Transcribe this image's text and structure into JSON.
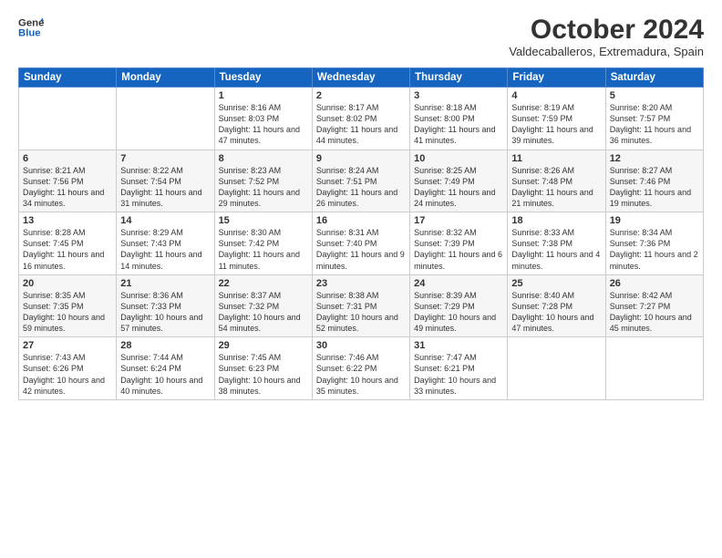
{
  "logo": {
    "line1": "General",
    "line2": "Blue"
  },
  "title": "October 2024",
  "subtitle": "Valdecaballeros, Extremadura, Spain",
  "weekdays": [
    "Sunday",
    "Monday",
    "Tuesday",
    "Wednesday",
    "Thursday",
    "Friday",
    "Saturday"
  ],
  "weeks": [
    [
      {
        "day": "",
        "detail": ""
      },
      {
        "day": "",
        "detail": ""
      },
      {
        "day": "1",
        "detail": "Sunrise: 8:16 AM\nSunset: 8:03 PM\nDaylight: 11 hours and 47 minutes."
      },
      {
        "day": "2",
        "detail": "Sunrise: 8:17 AM\nSunset: 8:02 PM\nDaylight: 11 hours and 44 minutes."
      },
      {
        "day": "3",
        "detail": "Sunrise: 8:18 AM\nSunset: 8:00 PM\nDaylight: 11 hours and 41 minutes."
      },
      {
        "day": "4",
        "detail": "Sunrise: 8:19 AM\nSunset: 7:59 PM\nDaylight: 11 hours and 39 minutes."
      },
      {
        "day": "5",
        "detail": "Sunrise: 8:20 AM\nSunset: 7:57 PM\nDaylight: 11 hours and 36 minutes."
      }
    ],
    [
      {
        "day": "6",
        "detail": "Sunrise: 8:21 AM\nSunset: 7:56 PM\nDaylight: 11 hours and 34 minutes."
      },
      {
        "day": "7",
        "detail": "Sunrise: 8:22 AM\nSunset: 7:54 PM\nDaylight: 11 hours and 31 minutes."
      },
      {
        "day": "8",
        "detail": "Sunrise: 8:23 AM\nSunset: 7:52 PM\nDaylight: 11 hours and 29 minutes."
      },
      {
        "day": "9",
        "detail": "Sunrise: 8:24 AM\nSunset: 7:51 PM\nDaylight: 11 hours and 26 minutes."
      },
      {
        "day": "10",
        "detail": "Sunrise: 8:25 AM\nSunset: 7:49 PM\nDaylight: 11 hours and 24 minutes."
      },
      {
        "day": "11",
        "detail": "Sunrise: 8:26 AM\nSunset: 7:48 PM\nDaylight: 11 hours and 21 minutes."
      },
      {
        "day": "12",
        "detail": "Sunrise: 8:27 AM\nSunset: 7:46 PM\nDaylight: 11 hours and 19 minutes."
      }
    ],
    [
      {
        "day": "13",
        "detail": "Sunrise: 8:28 AM\nSunset: 7:45 PM\nDaylight: 11 hours and 16 minutes."
      },
      {
        "day": "14",
        "detail": "Sunrise: 8:29 AM\nSunset: 7:43 PM\nDaylight: 11 hours and 14 minutes."
      },
      {
        "day": "15",
        "detail": "Sunrise: 8:30 AM\nSunset: 7:42 PM\nDaylight: 11 hours and 11 minutes."
      },
      {
        "day": "16",
        "detail": "Sunrise: 8:31 AM\nSunset: 7:40 PM\nDaylight: 11 hours and 9 minutes."
      },
      {
        "day": "17",
        "detail": "Sunrise: 8:32 AM\nSunset: 7:39 PM\nDaylight: 11 hours and 6 minutes."
      },
      {
        "day": "18",
        "detail": "Sunrise: 8:33 AM\nSunset: 7:38 PM\nDaylight: 11 hours and 4 minutes."
      },
      {
        "day": "19",
        "detail": "Sunrise: 8:34 AM\nSunset: 7:36 PM\nDaylight: 11 hours and 2 minutes."
      }
    ],
    [
      {
        "day": "20",
        "detail": "Sunrise: 8:35 AM\nSunset: 7:35 PM\nDaylight: 10 hours and 59 minutes."
      },
      {
        "day": "21",
        "detail": "Sunrise: 8:36 AM\nSunset: 7:33 PM\nDaylight: 10 hours and 57 minutes."
      },
      {
        "day": "22",
        "detail": "Sunrise: 8:37 AM\nSunset: 7:32 PM\nDaylight: 10 hours and 54 minutes."
      },
      {
        "day": "23",
        "detail": "Sunrise: 8:38 AM\nSunset: 7:31 PM\nDaylight: 10 hours and 52 minutes."
      },
      {
        "day": "24",
        "detail": "Sunrise: 8:39 AM\nSunset: 7:29 PM\nDaylight: 10 hours and 49 minutes."
      },
      {
        "day": "25",
        "detail": "Sunrise: 8:40 AM\nSunset: 7:28 PM\nDaylight: 10 hours and 47 minutes."
      },
      {
        "day": "26",
        "detail": "Sunrise: 8:42 AM\nSunset: 7:27 PM\nDaylight: 10 hours and 45 minutes."
      }
    ],
    [
      {
        "day": "27",
        "detail": "Sunrise: 7:43 AM\nSunset: 6:26 PM\nDaylight: 10 hours and 42 minutes."
      },
      {
        "day": "28",
        "detail": "Sunrise: 7:44 AM\nSunset: 6:24 PM\nDaylight: 10 hours and 40 minutes."
      },
      {
        "day": "29",
        "detail": "Sunrise: 7:45 AM\nSunset: 6:23 PM\nDaylight: 10 hours and 38 minutes."
      },
      {
        "day": "30",
        "detail": "Sunrise: 7:46 AM\nSunset: 6:22 PM\nDaylight: 10 hours and 35 minutes."
      },
      {
        "day": "31",
        "detail": "Sunrise: 7:47 AM\nSunset: 6:21 PM\nDaylight: 10 hours and 33 minutes."
      },
      {
        "day": "",
        "detail": ""
      },
      {
        "day": "",
        "detail": ""
      }
    ]
  ]
}
